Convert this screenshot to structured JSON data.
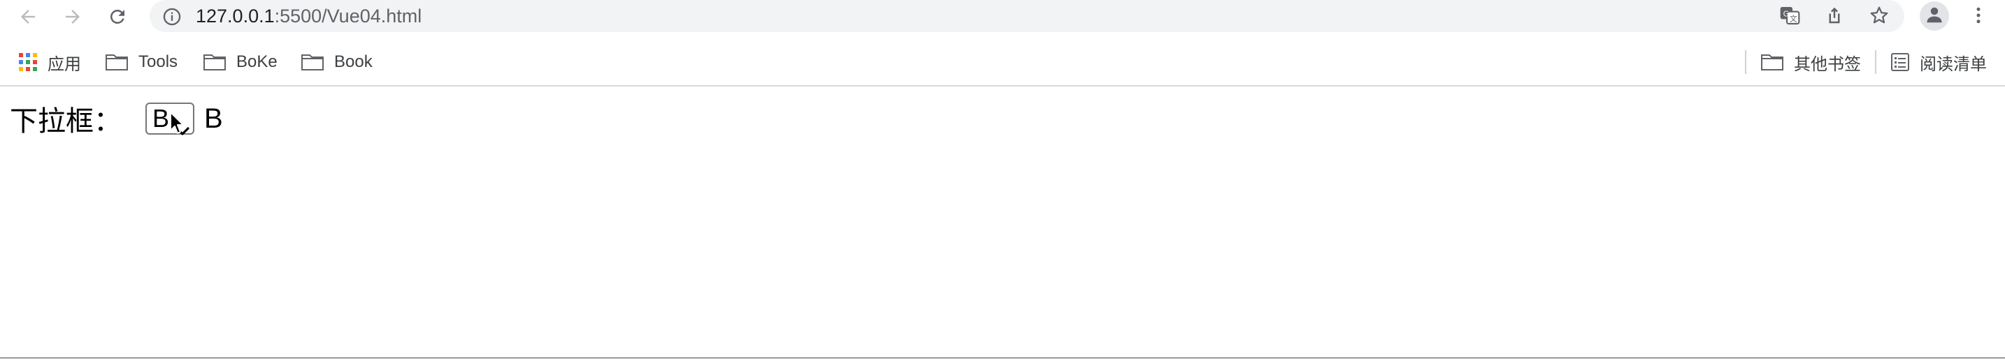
{
  "browser": {
    "url_host": "127.0.0.1",
    "url_rest": ":5500/Vue04.html",
    "icons": {
      "back": "back-arrow-icon",
      "forward": "forward-arrow-icon",
      "reload": "reload-icon",
      "site_info": "info-icon",
      "translate": "translate-icon",
      "share": "share-icon",
      "bookmark_star": "star-icon",
      "profile": "profile-icon",
      "menu": "kebab-menu-icon"
    }
  },
  "bookmarks": {
    "apps_label": "应用",
    "items": [
      {
        "label": "Tools"
      },
      {
        "label": "BoKe"
      },
      {
        "label": "Book"
      }
    ],
    "other_label": "其他书签",
    "reading_list_label": "阅读清单"
  },
  "page": {
    "dropdown_label": "下拉框：",
    "dropdown_value": "B",
    "selected_text": "B"
  }
}
